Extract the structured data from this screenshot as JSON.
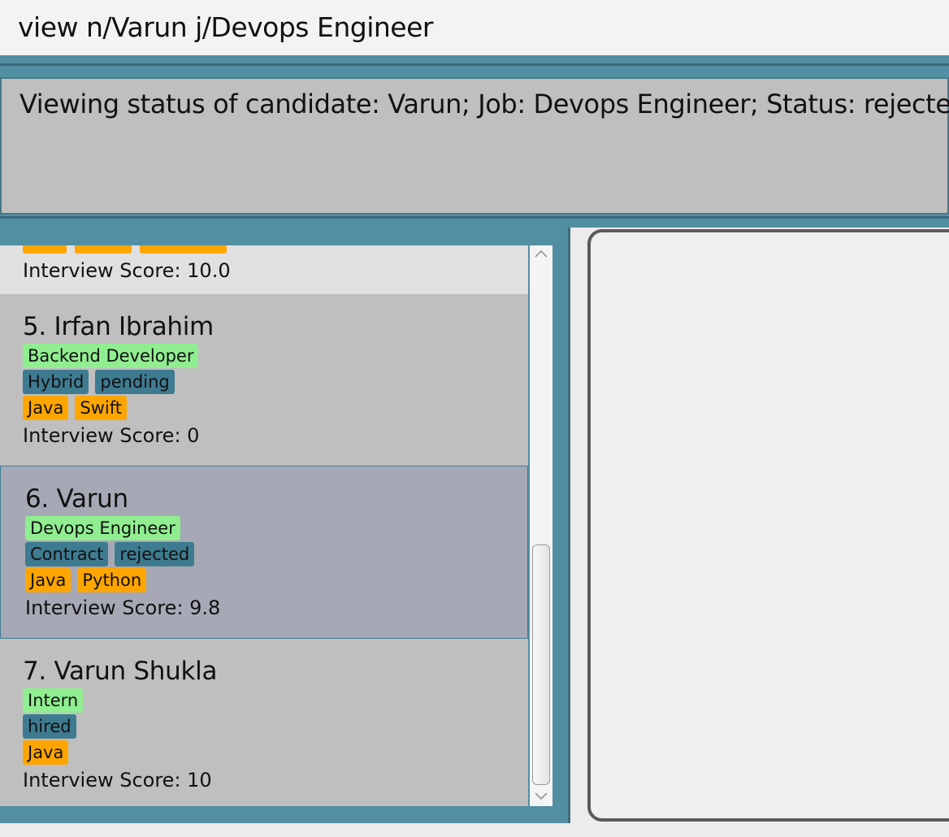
{
  "command": {
    "value": "view n/Varun j/Devops Engineer"
  },
  "result": {
    "message": "Viewing status of candidate: Varun; Job: Devops Engineer; Status: rejected"
  },
  "candidates": [
    {
      "name": "",
      "job": "",
      "statuses": [],
      "skills": [],
      "score": "Interview Score: 10.0"
    },
    {
      "name": "5. Irfan Ibrahim",
      "job": "Backend Developer",
      "statuses": [
        "Hybrid",
        "pending"
      ],
      "skills": [
        "Java",
        "Swift"
      ],
      "score": "Interview Score: 0"
    },
    {
      "name": "6. Varun",
      "job": "Devops Engineer",
      "statuses": [
        "Contract",
        "rejected"
      ],
      "skills": [
        "Java",
        "Python"
      ],
      "score": "Interview Score: 9.8"
    },
    {
      "name": "7. Varun Shukla",
      "job": "Intern",
      "statuses": [
        "hired"
      ],
      "skills": [
        "Java"
      ],
      "score": "Interview Score: 10"
    }
  ],
  "colors": {
    "accent": "#528fa3",
    "job_tag": "#90ee90",
    "status_tag": "#3e7b91",
    "skill_tag": "#ffa500",
    "selected_card": "#a6a9b5"
  },
  "icons": {
    "scroll_up": "chevron-up-icon",
    "scroll_down": "chevron-down-icon"
  }
}
